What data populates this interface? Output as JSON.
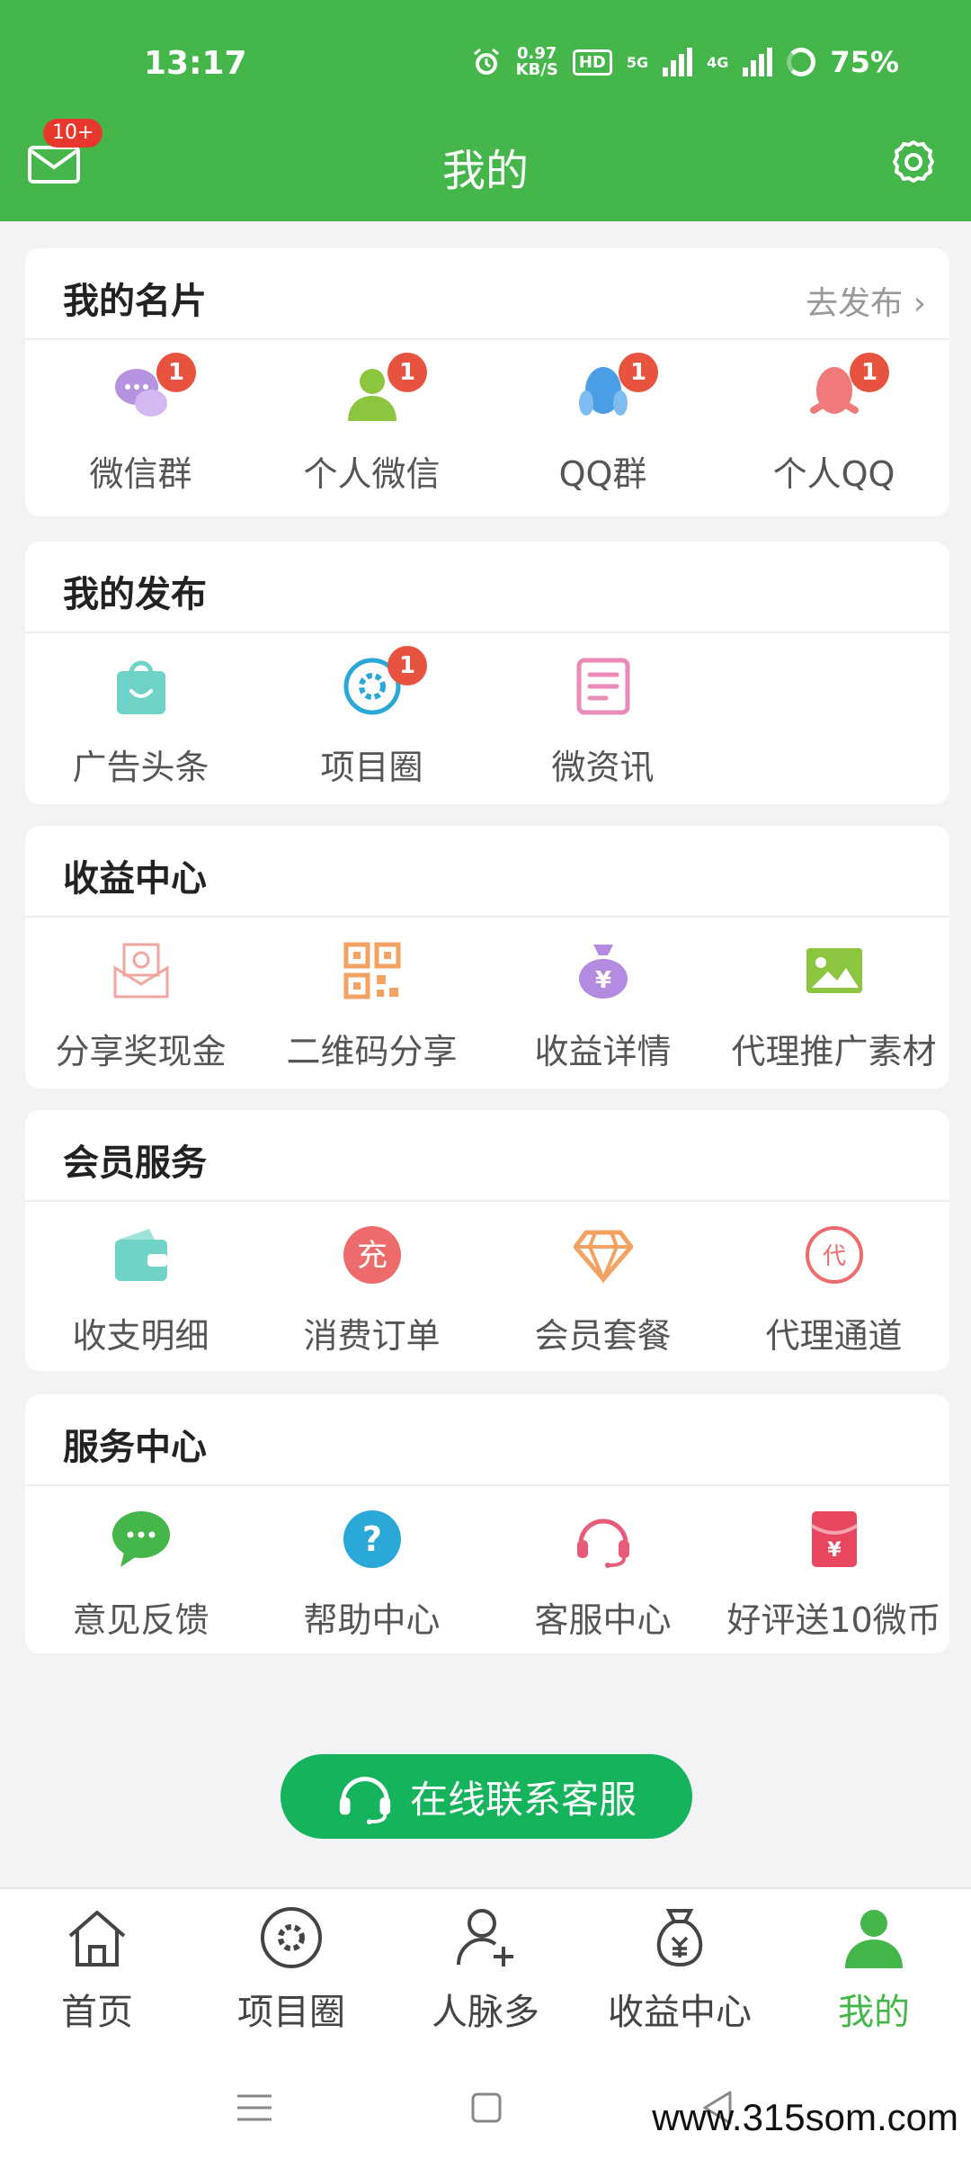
{
  "status_bar": {
    "time": "13:17",
    "speed_value": "0.97",
    "speed_unit": "KB/S",
    "hd_label": "HD",
    "net1": "5G",
    "net2": "4G",
    "battery": "75%"
  },
  "header": {
    "title": "我的",
    "mail_badge": "10+"
  },
  "sections": [
    {
      "title": "我的名片",
      "link": "去发布 ›",
      "items": [
        {
          "label": "微信群",
          "icon": "wechat-group-icon",
          "badge": "1",
          "color": "#b593e0"
        },
        {
          "label": "个人微信",
          "icon": "person-icon",
          "badge": "1",
          "color": "#8cc63f"
        },
        {
          "label": "QQ群",
          "icon": "qq-group-icon",
          "badge": "1",
          "color": "#4a9ee6"
        },
        {
          "label": "个人QQ",
          "icon": "qq-icon",
          "badge": "1",
          "color": "#f07a7a"
        }
      ]
    },
    {
      "title": "我的发布",
      "items": [
        {
          "label": "广告头条",
          "icon": "shopping-bag-icon",
          "color": "#6fd4c7"
        },
        {
          "label": "项目圈",
          "icon": "gear-circle-icon",
          "badge": "1",
          "color": "#2aa8d8"
        },
        {
          "label": "微资讯",
          "icon": "document-icon",
          "color": "#e98ab8"
        }
      ]
    },
    {
      "title": "收益中心",
      "items": [
        {
          "label": "分享奖现金",
          "icon": "cash-envelope-icon",
          "color": "#f2a6a0"
        },
        {
          "label": "二维码分享",
          "icon": "qr-code-icon",
          "color": "#f4a261"
        },
        {
          "label": "收益详情",
          "icon": "money-bag-icon",
          "color": "#b38be0"
        },
        {
          "label": "代理推广素材",
          "icon": "image-icon",
          "color": "#8cc63f"
        }
      ]
    },
    {
      "title": "会员服务",
      "items": [
        {
          "label": "收支明细",
          "icon": "wallet-icon",
          "color": "#6fd4c7"
        },
        {
          "label": "消费订单",
          "icon": "recharge-icon",
          "glyph": "充",
          "color": "#ee6b6b"
        },
        {
          "label": "会员套餐",
          "icon": "diamond-icon",
          "color": "#f4a261"
        },
        {
          "label": "代理通道",
          "icon": "agent-icon",
          "glyph": "代",
          "color": "#ee6b6b"
        }
      ]
    },
    {
      "title": "服务中心",
      "items": [
        {
          "label": "意见反馈",
          "icon": "chat-bubble-icon",
          "color": "#45b649"
        },
        {
          "label": "帮助中心",
          "icon": "help-icon",
          "glyph": "?",
          "color": "#2aa8d8"
        },
        {
          "label": "客服中心",
          "icon": "headset-icon",
          "color": "#e85c7a"
        },
        {
          "label": "好评送10微币",
          "icon": "red-envelope-icon",
          "color": "#e8475f"
        }
      ]
    }
  ],
  "cta": {
    "label": "在线联系客服",
    "icon": "headset-icon"
  },
  "tabs": [
    {
      "label": "首页",
      "icon": "home-icon",
      "active": false
    },
    {
      "label": "项目圈",
      "icon": "gear-circle-icon",
      "active": false
    },
    {
      "label": "人脉多",
      "icon": "add-user-icon",
      "active": false
    },
    {
      "label": "收益中心",
      "icon": "money-bag-icon",
      "active": false
    },
    {
      "label": "我的",
      "icon": "person-icon",
      "active": true
    }
  ],
  "watermark": "www.315som.com",
  "colors": {
    "brand": "#45b649",
    "cta": "#14b35c",
    "badge": "#e8533f"
  }
}
